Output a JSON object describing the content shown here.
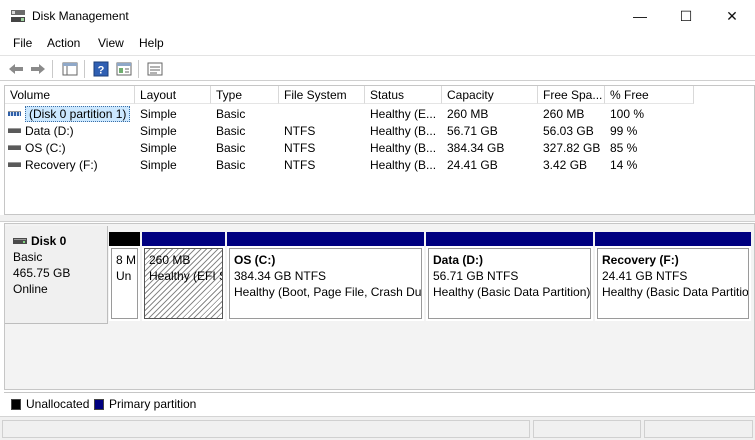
{
  "window": {
    "title": "Disk Management",
    "minimize_glyph": "—",
    "maximize_glyph": "☐",
    "close_glyph": "✕"
  },
  "menu": [
    "File",
    "Action",
    "View",
    "Help"
  ],
  "toolbar": {
    "buttons": [
      "back-icon",
      "forward-icon",
      "console-tree-icon",
      "help-icon",
      "properties-icon",
      "list-view-icon"
    ]
  },
  "volume_list": {
    "columns": [
      "Volume",
      "Layout",
      "Type",
      "File System",
      "Status",
      "Capacity",
      "Free Spa...",
      "% Free"
    ],
    "rows": [
      {
        "volume": "(Disk 0 partition 1)",
        "layout": "Simple",
        "type": "Basic",
        "fs": "",
        "status": "Healthy (E...",
        "capacity": "260 MB",
        "free": "260 MB",
        "pct": "100 %"
      },
      {
        "volume": "Data (D:)",
        "layout": "Simple",
        "type": "Basic",
        "fs": "NTFS",
        "status": "Healthy (B...",
        "capacity": "56.71 GB",
        "free": "56.03 GB",
        "pct": "99 %"
      },
      {
        "volume": "OS (C:)",
        "layout": "Simple",
        "type": "Basic",
        "fs": "NTFS",
        "status": "Healthy (B...",
        "capacity": "384.34 GB",
        "free": "327.82 GB",
        "pct": "85 %"
      },
      {
        "volume": "Recovery (F:)",
        "layout": "Simple",
        "type": "Basic",
        "fs": "NTFS",
        "status": "Healthy (B...",
        "capacity": "24.41 GB",
        "free": "3.42 GB",
        "pct": "14 %"
      }
    ]
  },
  "disk": {
    "name": "Disk 0",
    "type": "Basic",
    "size": "465.75 GB",
    "state": "Online"
  },
  "partitions": {
    "unalloc": {
      "line1": "8 M",
      "line2": "Un"
    },
    "efi": {
      "line1": "260 MB",
      "line2": "Healthy (EFI S"
    },
    "os": {
      "title": "OS  (C:)",
      "line1": "384.34 GB NTFS",
      "line2": "Healthy (Boot, Page File, Crash Du"
    },
    "data": {
      "title": "Data  (D:)",
      "line1": "56.71 GB NTFS",
      "line2": "Healthy (Basic Data Partition)"
    },
    "recovery": {
      "title": "Recovery  (F:)",
      "line1": "24.41 GB NTFS",
      "line2": "Healthy (Basic Data Partitio"
    }
  },
  "legend": {
    "unallocated": "Unallocated",
    "primary": "Primary partition"
  },
  "colors": {
    "primary_partition": "#000080",
    "unallocated": "#000000",
    "selection": "#cce8ff"
  }
}
